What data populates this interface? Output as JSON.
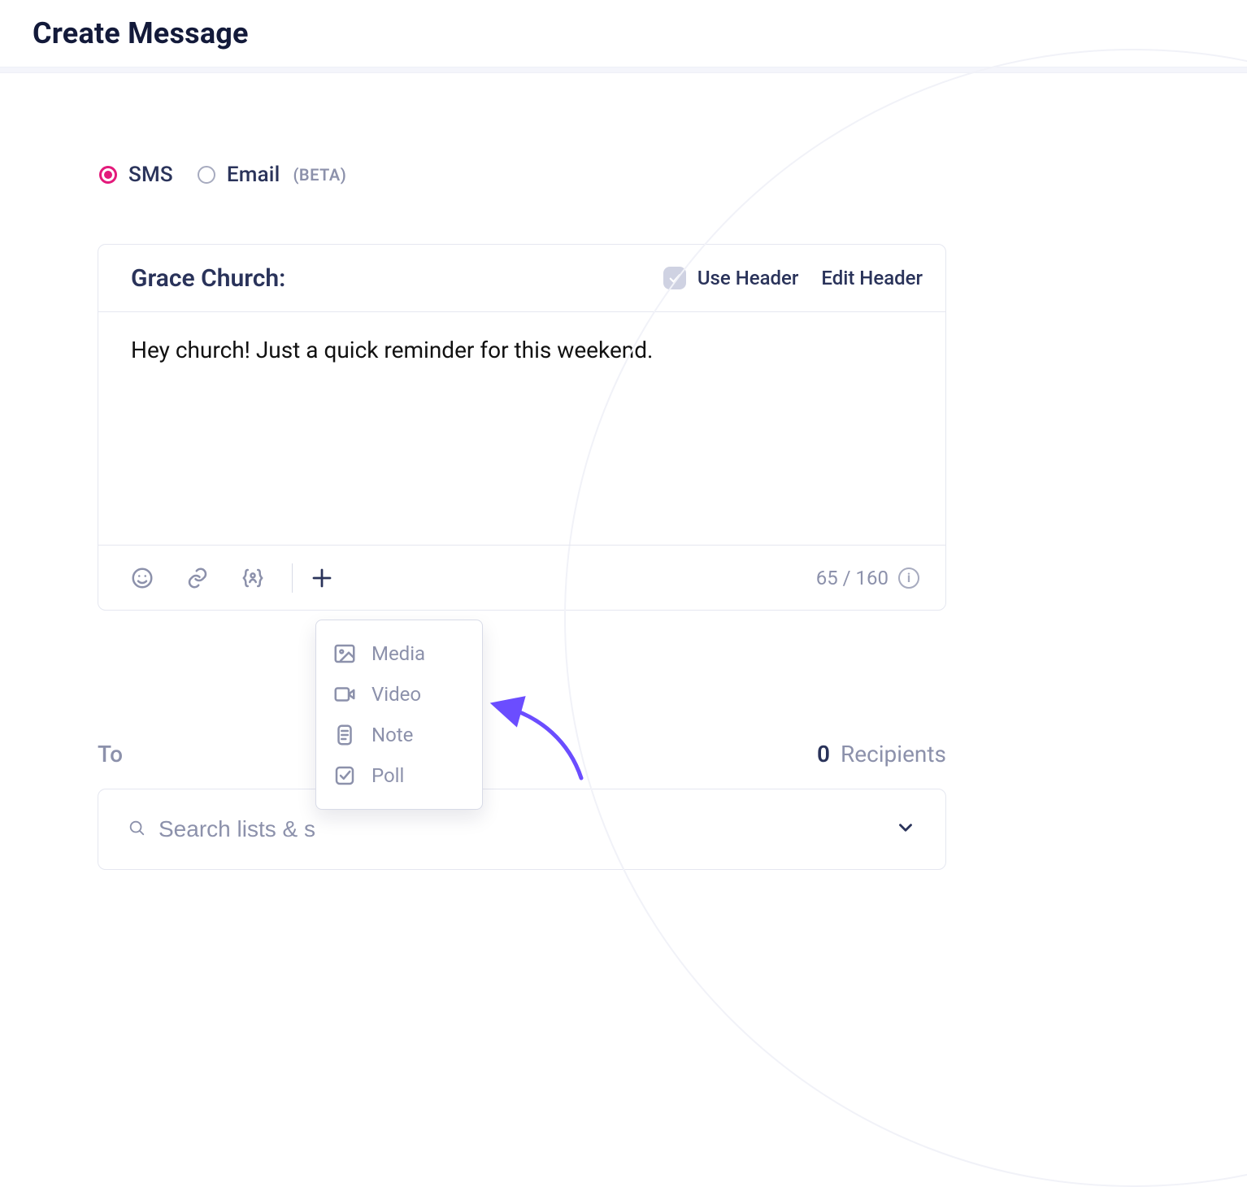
{
  "header": {
    "title": "Create Message"
  },
  "type_selector": {
    "sms": {
      "label": "SMS",
      "selected": true
    },
    "email": {
      "label": "Email",
      "beta_label": "(BETA)",
      "selected": false
    }
  },
  "composer": {
    "header_title": "Grace Church:",
    "use_header_label": "Use Header",
    "use_header_checked": true,
    "edit_header_label": "Edit Header",
    "message": "Hey church! Just a quick reminder for this weekend.",
    "char_counter": "65 / 160",
    "add_menu": {
      "items": [
        {
          "icon": "image-icon",
          "label": "Media"
        },
        {
          "icon": "video-icon",
          "label": "Video"
        },
        {
          "icon": "note-icon",
          "label": "Note"
        },
        {
          "icon": "poll-icon",
          "label": "Poll"
        }
      ]
    }
  },
  "recipients": {
    "to_label": "To",
    "count": "0",
    "count_label": "Recipients",
    "search_placeholder": "Search lists & s"
  },
  "annotations": {
    "arrow_color": "#6b4dff"
  }
}
